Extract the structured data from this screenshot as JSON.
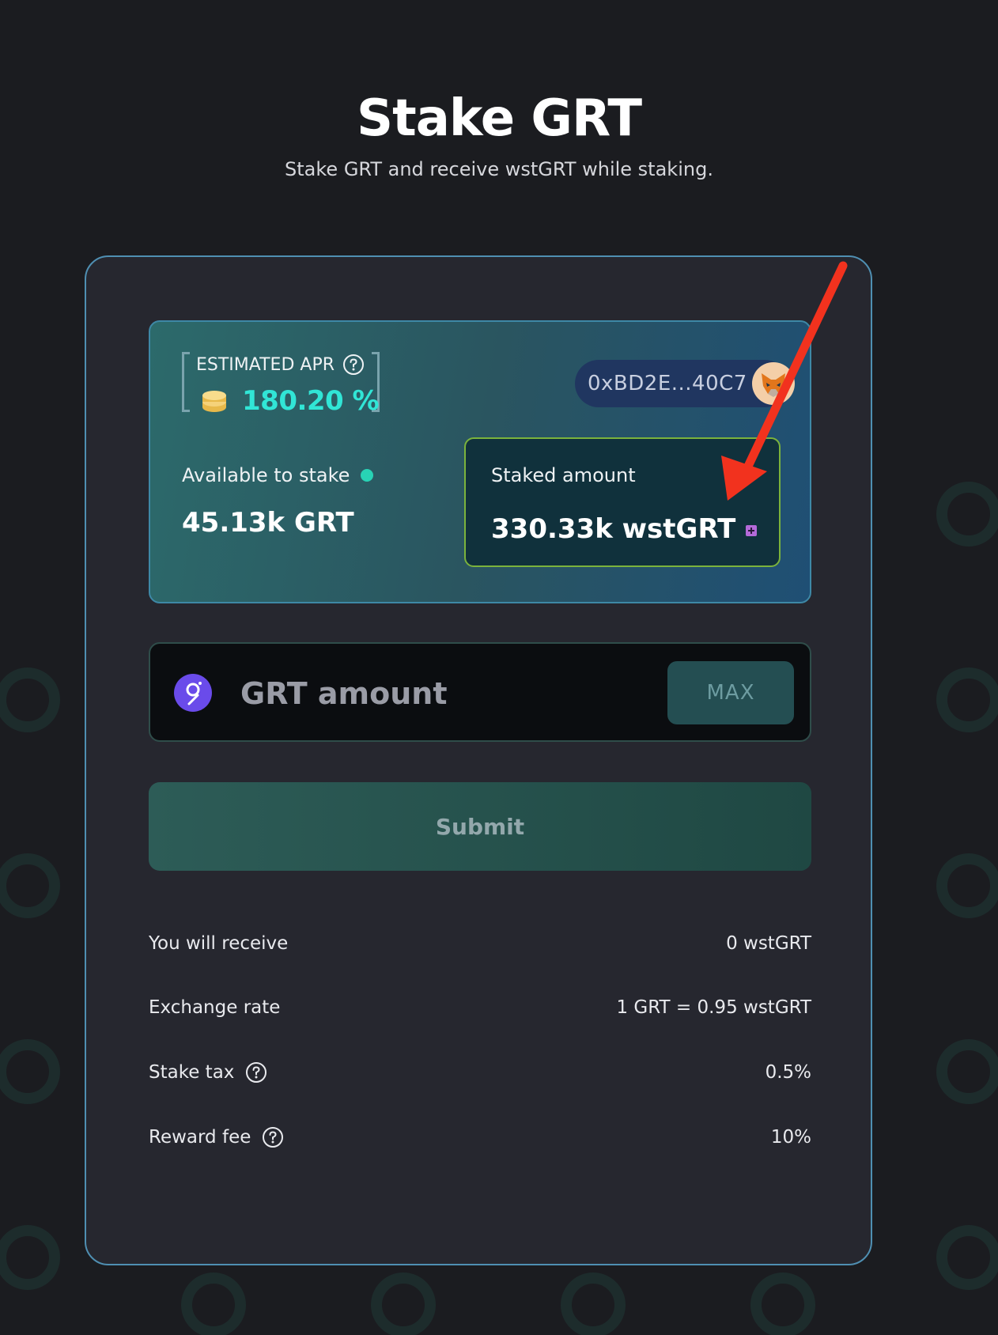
{
  "header": {
    "title": "Stake GRT",
    "subtitle": "Stake GRT and receive wstGRT while staking."
  },
  "info_panel": {
    "apr_label": "ESTIMATED APR",
    "apr_value": "180.20 %",
    "wallet_address": "0xBD2E...40C7",
    "available_label": "Available to stake",
    "available_value": "45.13k GRT",
    "staked_label": "Staked amount",
    "staked_value": "330.33k wstGRT"
  },
  "amount_input": {
    "placeholder": "GRT amount",
    "value": "",
    "max_label": "MAX"
  },
  "submit": {
    "label": "Submit"
  },
  "details": {
    "receive_label": "You will receive",
    "receive_value": "0 wstGRT",
    "rate_label": "Exchange rate",
    "rate_value": "1 GRT = 0.95 wstGRT",
    "tax_label": "Stake tax",
    "tax_value": "0.5%",
    "fee_label": "Reward fee",
    "fee_value": "10%"
  },
  "icons": {
    "apr_coin": "coin-stack-icon",
    "help": "question-circle-icon",
    "wallet": "metamask-fox-icon",
    "add_token": "plus-square-icon",
    "token": "graph-token-icon"
  },
  "colors": {
    "background": "#1b1c20",
    "card": "#26272f",
    "card_border": "#4f8fb2",
    "apr_accent": "#31e6d6",
    "status_dot": "#28d3b5",
    "staked_border": "#7bb33c",
    "token_icon": "#6a4bea",
    "annotation_arrow": "#f2321e"
  }
}
